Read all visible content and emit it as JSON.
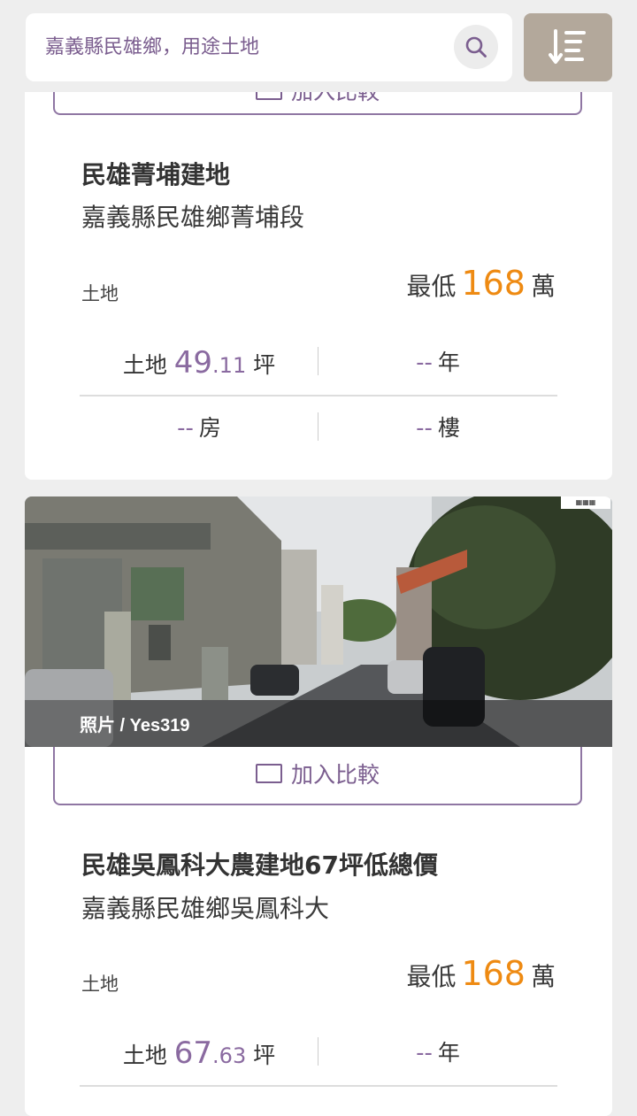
{
  "search": {
    "query": "嘉義縣民雄鄉，用途土地"
  },
  "compare_label": "加入比較",
  "listings": [
    {
      "title": "民雄菁埔建地",
      "address": "嘉義縣民雄鄉菁埔段",
      "type": "土地",
      "price_prefix": "最低",
      "price_value": "168",
      "price_unit": "萬",
      "land_label": "土地",
      "land_int": "49",
      "land_dec": ".11",
      "land_unit": "坪",
      "age_value": "--",
      "age_unit": "年",
      "rooms_value": "--",
      "rooms_unit": "房",
      "floor_value": "--",
      "floor_unit": "樓"
    },
    {
      "title": "民雄吳鳳科大農建地67坪低總價",
      "address": "嘉義縣民雄鄉吳鳳科大",
      "type": "土地",
      "price_prefix": "最低",
      "price_value": "168",
      "price_unit": "萬",
      "land_label": "土地",
      "land_int": "67",
      "land_dec": ".63",
      "land_unit": "坪",
      "age_value": "--",
      "age_unit": "年",
      "photo_credit": "照片 /  Yes319"
    }
  ],
  "colors": {
    "accent_purple": "#7b5e8f",
    "price_orange": "#ee8a12",
    "sort_button_bg": "#b3a89b"
  }
}
